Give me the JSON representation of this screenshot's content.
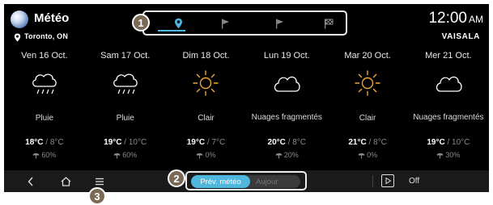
{
  "header": {
    "app_title": "Météo",
    "location": "Toronto, ON",
    "clock_time": "12:00",
    "clock_ampm": "AM",
    "provider": "VAISALA"
  },
  "tabs": [
    {
      "icon": "location-pin-icon",
      "active": true
    },
    {
      "icon": "flag-icon",
      "active": false
    },
    {
      "icon": "flag-icon",
      "active": false
    },
    {
      "icon": "checkered-flag-icon",
      "active": false
    }
  ],
  "callouts": {
    "one": "1",
    "two": "2",
    "three": "3"
  },
  "forecast": [
    {
      "day": "Ven 16 Oct.",
      "icon": "rain-cloud-icon",
      "condition": "Pluie",
      "hi": "18°C",
      "lo": "8°C",
      "precip": "60%"
    },
    {
      "day": "Sam 17 Oct.",
      "icon": "rain-cloud-icon",
      "condition": "Pluie",
      "hi": "19°C",
      "lo": "10°C",
      "precip": "60%"
    },
    {
      "day": "Dim 18 Oct.",
      "icon": "sun-icon",
      "condition": "Clair",
      "hi": "19°C",
      "lo": "7°C",
      "precip": "0%"
    },
    {
      "day": "Lun 19 Oct.",
      "icon": "cloud-icon",
      "condition": "Nuages fragmentés",
      "hi": "20°C",
      "lo": "8°C",
      "precip": "20%"
    },
    {
      "day": "Mar 20 Oct.",
      "icon": "sun-icon",
      "condition": "Clair",
      "hi": "21°C",
      "lo": "8°C",
      "precip": "0%"
    },
    {
      "day": "Mer 21 Oct.",
      "icon": "cloud-icon",
      "condition": "Nuages fragmentés",
      "hi": "19°C",
      "lo": "10°C",
      "precip": "30%"
    }
  ],
  "bottom_bar": {
    "toggle_active": "Prév. météo",
    "toggle_inactive": "Aujour",
    "play_label": "Off"
  },
  "colors": {
    "accent": "#4fb6de",
    "background": "#000000",
    "bar": "#1a1a1a",
    "callout": "#7a6a55"
  }
}
